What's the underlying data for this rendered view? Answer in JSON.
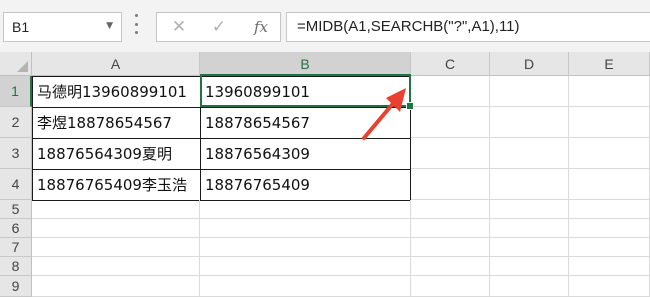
{
  "formula_bar": {
    "name_box": "B1",
    "formula": "=MIDB(A1,SEARCHB(\"?\",A1),11)",
    "icons": [
      "cancel-x-icon",
      "enter-check-icon",
      "function-fx-icon"
    ]
  },
  "columns": [
    "A",
    "B",
    "C",
    "D",
    "E"
  ],
  "active_column": "B",
  "rows": [
    "1",
    "2",
    "3",
    "4",
    "5",
    "6",
    "7",
    "8",
    "9"
  ],
  "active_row": "1",
  "cells": [
    {
      "a": "马德明13960899101",
      "b": "13960899101"
    },
    {
      "a": "李煜18878654567",
      "b": "18878654567"
    },
    {
      "a": "18876564309夏明",
      "b": "18876564309"
    },
    {
      "a": "18876765409李玉浩",
      "b": "18876765409"
    }
  ],
  "colors": {
    "accent": "#217346",
    "annotation_arrow": "#e8412f"
  }
}
